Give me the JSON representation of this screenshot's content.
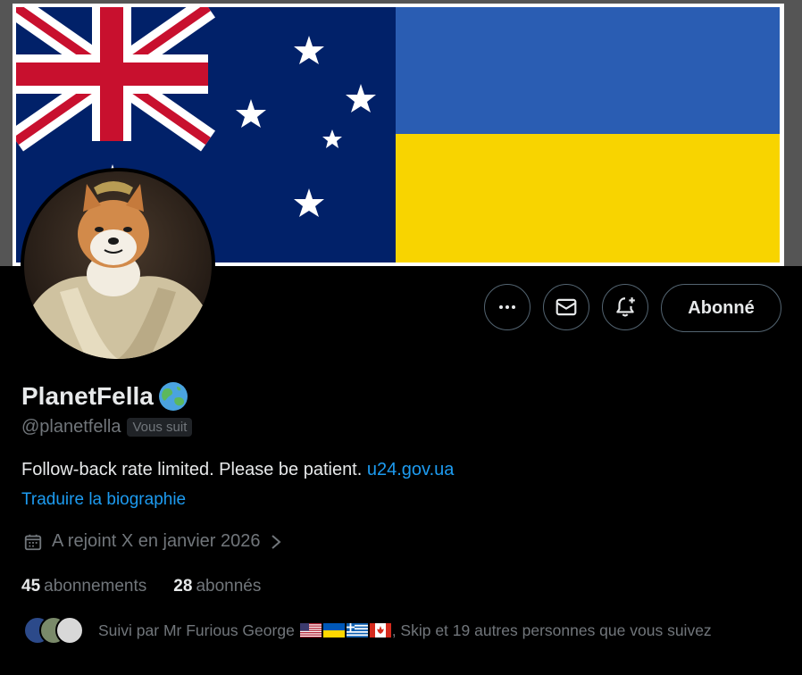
{
  "profile": {
    "display_name": "PlanetFella",
    "name_emoji": "globe-asia-australia-emoji",
    "handle": "@planetfella",
    "follows_you_badge": "Vous suit",
    "bio_text": "Follow-back rate limited. Please be patient.",
    "bio_link": "u24.gov.ua",
    "translate_label": "Traduire la biographie",
    "joined_text": "A rejoint X en janvier 2026"
  },
  "actions": {
    "more_icon": "more-icon",
    "message_icon": "mail-icon",
    "notify_icon": "bell-add-icon",
    "follow_label": "Abonné"
  },
  "stats": {
    "following_count": "45",
    "following_label": "abonnements",
    "followers_count": "28",
    "followers_label": "abonnés"
  },
  "followed_by": {
    "prefix": "Suivi par Mr Furious George",
    "suffix": ", Skip et 19 autres personnes que vous suivez",
    "flags": [
      "us-flag",
      "ua-flag",
      "gr-flag",
      "ca-flag"
    ]
  },
  "colors": {
    "accent": "#1d9bf0",
    "background": "#000000",
    "muted": "#71767b",
    "ukraine_blue": "#2a5db3",
    "ukraine_yellow": "#f8d400",
    "australia_blue": "#012169"
  }
}
